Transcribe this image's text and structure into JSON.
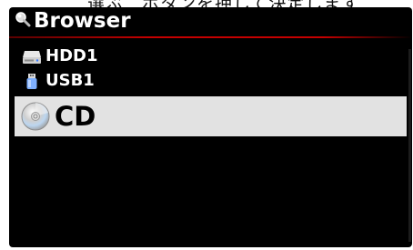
{
  "top_strip": {
    "text": "選ぶ　ボタンを押して決定します"
  },
  "header": {
    "icon": "magnifier-icon",
    "title": "Browser"
  },
  "list": {
    "items": [
      {
        "label": "HDD1",
        "icon": "hard-drive-icon"
      },
      {
        "label": "USB1",
        "icon": "usb-drive-icon"
      },
      {
        "label": "CD",
        "icon": "cd-disc-icon",
        "selected": true
      }
    ]
  },
  "colors": {
    "background": "#000000",
    "text": "#ffffff",
    "selection": "#e2e2e2",
    "accent_rule": "#c40000"
  }
}
